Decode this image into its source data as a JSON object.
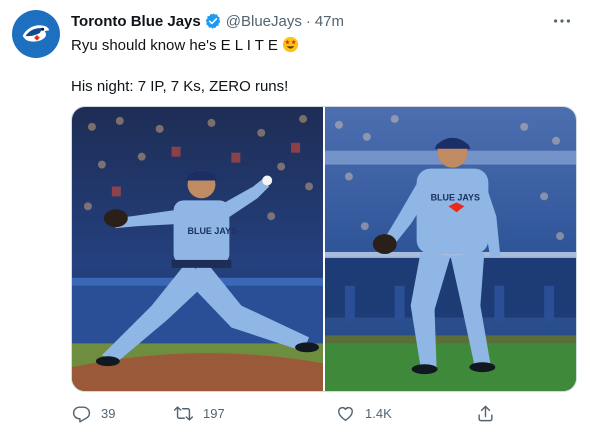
{
  "tweet": {
    "author": {
      "name": "Toronto Blue Jays",
      "handle": "@BlueJays",
      "separator": "·",
      "time": "47m",
      "verified": true
    },
    "text_line1": "Ryu should know he's E L I T E",
    "text_line1_emoji": "star-struck-emoji",
    "text_line2": "His night: 7 IP, 7 Ks, ZERO runs!",
    "media": [
      {
        "id": "photo-pitching",
        "jersey": "BLUE JAYS"
      },
      {
        "id": "photo-walking",
        "jersey": "BLUE JAYS"
      }
    ],
    "actions": {
      "reply_count": "39",
      "retweet_count": "197",
      "like_count": "1.4K"
    }
  },
  "colors": {
    "accent": "#1d9bf0",
    "text": "#0f1419",
    "secondary": "#536471",
    "jersey": "#8fb6e4",
    "field": "#3e8a3a"
  },
  "icons": [
    "blue-jays-logo-icon",
    "verified-badge-icon",
    "more-icon",
    "reply-icon",
    "retweet-icon",
    "like-icon",
    "share-icon"
  ]
}
